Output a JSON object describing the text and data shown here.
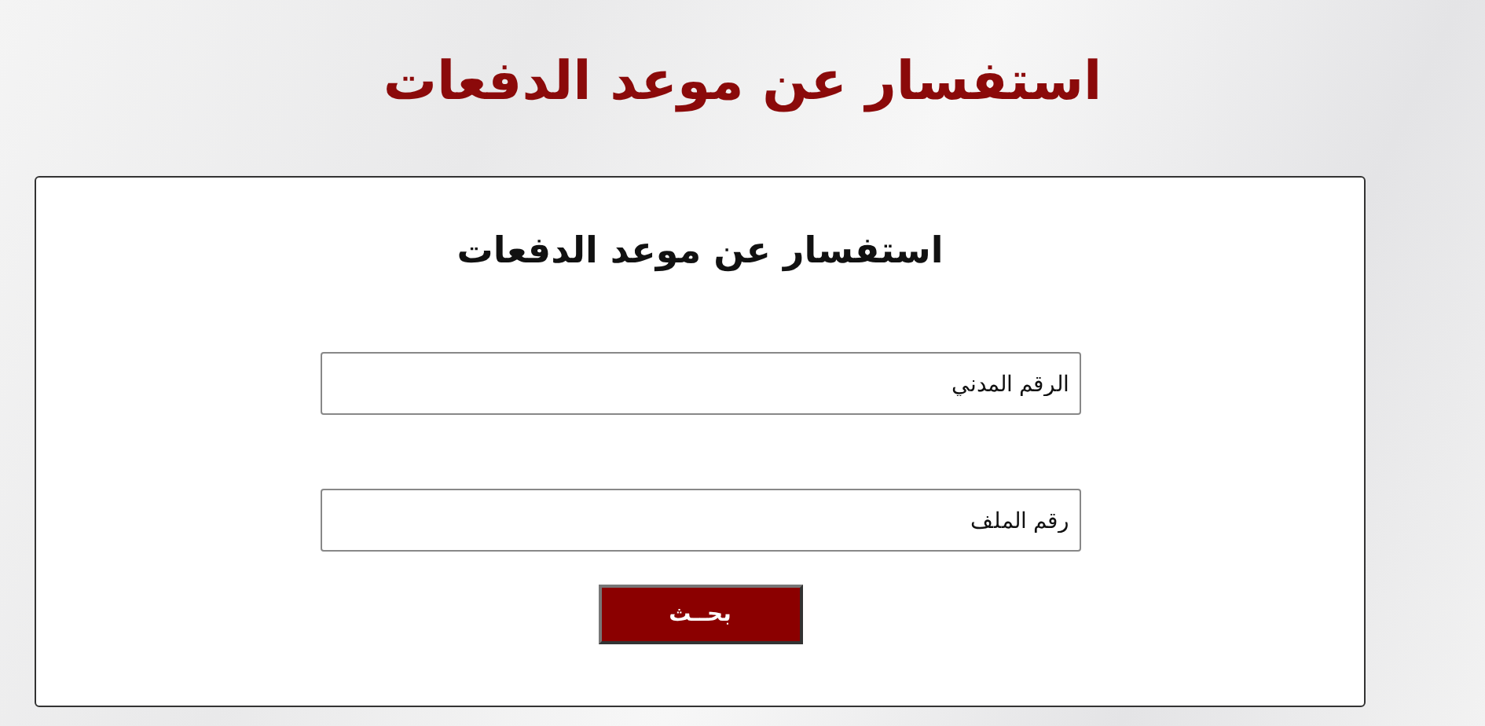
{
  "page_title": "استفسار عن موعد الدفعات",
  "form": {
    "title": "استفسار عن موعد الدفعات",
    "fields": [
      {
        "placeholder": "الرقم المدني"
      },
      {
        "placeholder": "رقم الملف"
      }
    ],
    "button": "بحــث"
  }
}
